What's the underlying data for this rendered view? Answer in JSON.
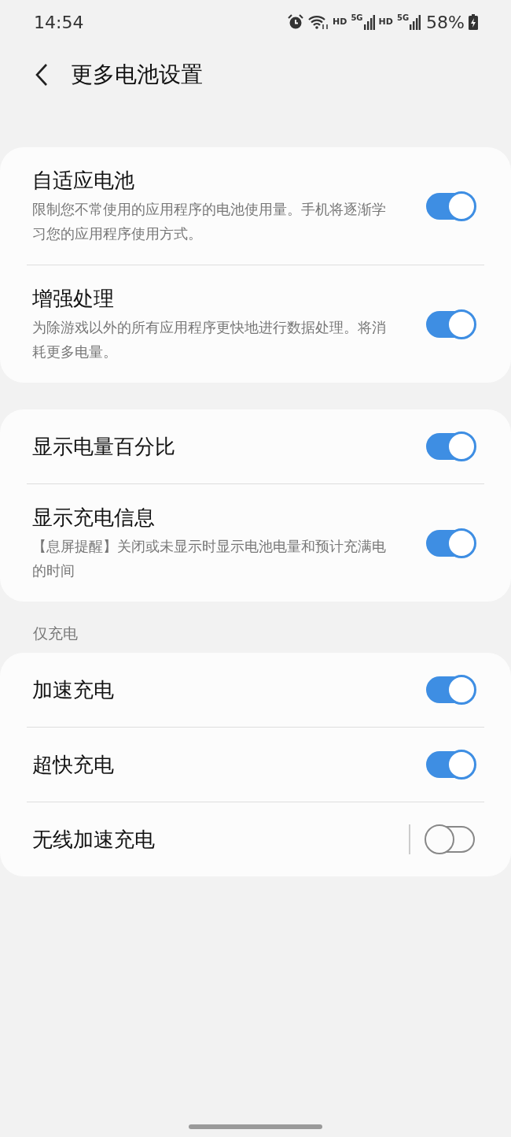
{
  "status_bar": {
    "time": "14:54",
    "network_labels": [
      "HD",
      "5G",
      "HD",
      "5G"
    ],
    "battery": "58%"
  },
  "header": {
    "title": "更多电池设置"
  },
  "groups": [
    {
      "items": [
        {
          "title": "自适应电池",
          "description": "限制您不常使用的应用程序的电池使用量。手机将逐渐学习您的应用程序使用方式。",
          "on": true,
          "split": false
        },
        {
          "title": "增强处理",
          "description": "为除游戏以外的所有应用程序更快地进行数据处理。将消耗更多电量。",
          "on": true,
          "split": false
        }
      ]
    },
    {
      "items": [
        {
          "title": "显示电量百分比",
          "on": true,
          "split": false
        },
        {
          "title": "显示充电信息",
          "description": "【息屏提醒】关闭或未显示时显示电池电量和预计充满电的时间",
          "on": true,
          "split": false
        }
      ]
    },
    {
      "heading": "仅充电",
      "items": [
        {
          "title": "加速充电",
          "on": true,
          "split": false
        },
        {
          "title": "超快充电",
          "on": true,
          "split": false
        },
        {
          "title": "无线加速充电",
          "on": false,
          "split": true
        }
      ]
    }
  ]
}
